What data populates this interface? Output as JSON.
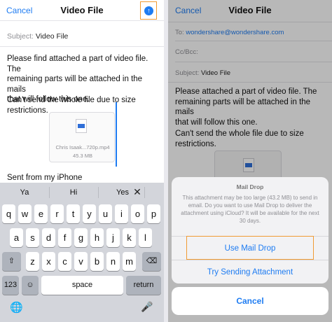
{
  "left": {
    "nav": {
      "cancel": "Cancel",
      "title": "Video File"
    },
    "subject_label": "Subject:",
    "subject_value": "Video File",
    "body_lines": [
      "Please find attached a part of video file. The",
      "remaining parts will be attached in the mails",
      "that will follow this one."
    ],
    "body_lines_2": [
      "Can't send the whole file due to size",
      "restrictions."
    ],
    "attachment": {
      "name": "Chris Isaak...720p.mp4",
      "size": "45.3 MB"
    },
    "signature": "Sent from my iPhone",
    "keyboard": {
      "suggestions": [
        "Ya",
        "Hi",
        "Yes"
      ],
      "row1": [
        "q",
        "w",
        "e",
        "r",
        "t",
        "y",
        "u",
        "i",
        "o",
        "p"
      ],
      "row2": [
        "a",
        "s",
        "d",
        "f",
        "g",
        "h",
        "j",
        "k",
        "l"
      ],
      "row3": [
        "z",
        "x",
        "c",
        "v",
        "b",
        "n",
        "m"
      ],
      "shift": "⇧",
      "backspace": "⌫",
      "numbers": "123",
      "emoji": "☺",
      "space": "space",
      "return": "return",
      "globe": "🌐",
      "mic": "🎤"
    }
  },
  "right": {
    "nav": {
      "cancel": "Cancel",
      "title": "Video File"
    },
    "to_label": "To:",
    "to_value": "wondershare@wondershare.com",
    "cc_label": "Cc/Bcc:",
    "subject_label": "Subject:",
    "subject_value": "Video File",
    "body_lines": [
      "Please attached a part of video file. The",
      "remaining parts will be attached in the mails",
      "that will follow this one."
    ],
    "body_lines_2": [
      "Can't send the whole file due to size",
      "restrictions."
    ],
    "sheet": {
      "title": "Mail Drop",
      "message": "This attachment may be too large (43.2 MB) to send in email. Do you want to use Mail Drop to deliver the attachment using iCloud? It will be available for the next 30 days.",
      "option1": "Use Mail Drop",
      "option2": "Try Sending Attachment",
      "cancel": "Cancel"
    }
  },
  "colors": {
    "accent": "#1e7cf2",
    "highlight": "#f09b33"
  }
}
